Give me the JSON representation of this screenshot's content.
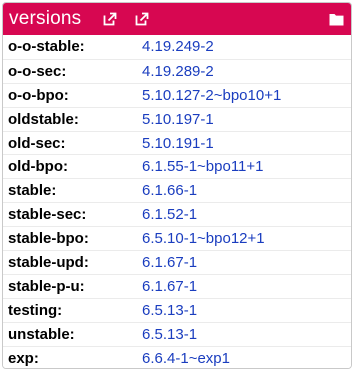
{
  "header": {
    "title": "versions",
    "icons": [
      "external-link-icon",
      "external-link-icon",
      "folder-icon"
    ],
    "accent_color": "#d70751"
  },
  "rows": [
    {
      "suite": "o-o-stable:",
      "version": "4.19.249-2"
    },
    {
      "suite": "o-o-sec:",
      "version": "4.19.289-2"
    },
    {
      "suite": "o-o-bpo:",
      "version": "5.10.127-2~bpo10+1"
    },
    {
      "suite": "oldstable:",
      "version": "5.10.197-1"
    },
    {
      "suite": "old-sec:",
      "version": "5.10.191-1"
    },
    {
      "suite": "old-bpo:",
      "version": "6.1.55-1~bpo11+1"
    },
    {
      "suite": "stable:",
      "version": "6.1.66-1"
    },
    {
      "suite": "stable-sec:",
      "version": "6.1.52-1"
    },
    {
      "suite": "stable-bpo:",
      "version": "6.5.10-1~bpo12+1"
    },
    {
      "suite": "stable-upd:",
      "version": "6.1.67-1"
    },
    {
      "suite": "stable-p-u:",
      "version": "6.1.67-1"
    },
    {
      "suite": "testing:",
      "version": "6.5.13-1"
    },
    {
      "suite": "unstable:",
      "version": "6.5.13-1"
    },
    {
      "suite": "exp:",
      "version": "6.6.4-1~exp1"
    }
  ]
}
